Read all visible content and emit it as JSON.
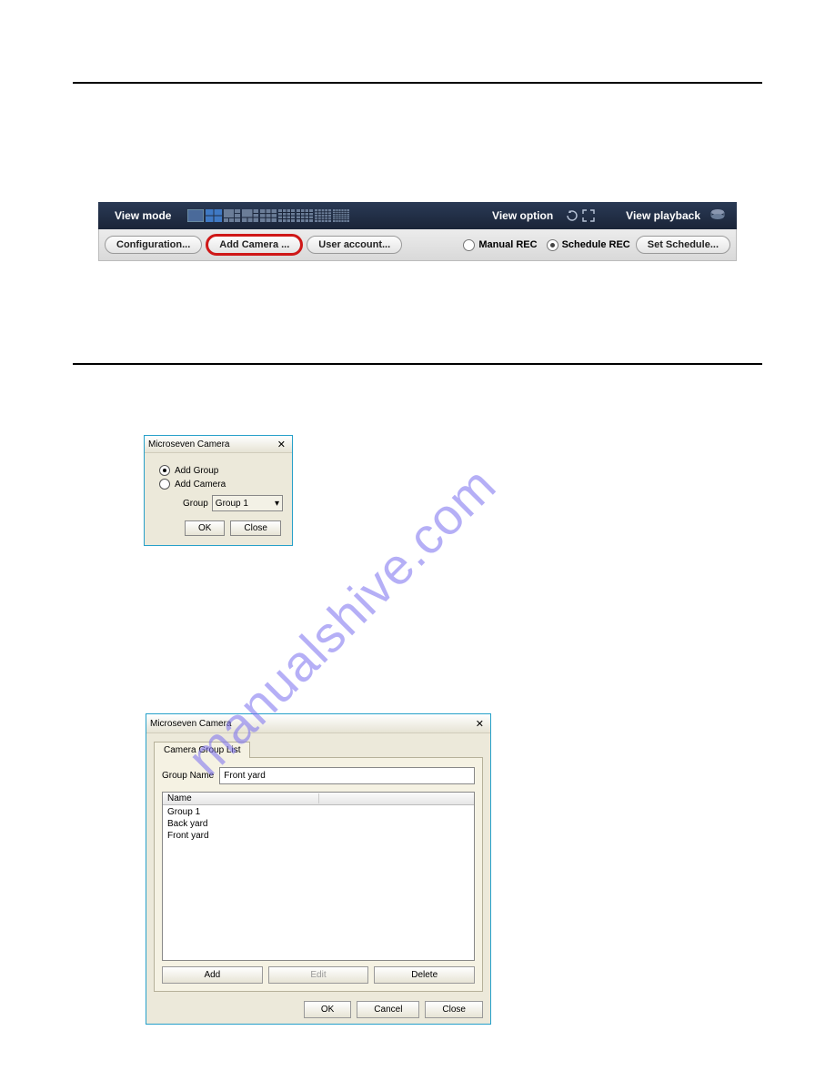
{
  "watermark": "manualshive.com",
  "toolbar": {
    "view_mode_label": "View mode",
    "view_option_label": "View option",
    "view_playback_label": "View playback",
    "configuration_label": "Configuration...",
    "add_camera_label": "Add Camera ...",
    "user_account_label": "User account...",
    "manual_rec_label": "Manual REC",
    "schedule_rec_label": "Schedule REC",
    "set_schedule_label": "Set Schedule..."
  },
  "dialog_small": {
    "title": "Microseven Camera",
    "add_group_label": "Add Group",
    "add_camera_label": "Add Camera",
    "group_label": "Group",
    "group_value": "Group 1",
    "ok_label": "OK",
    "close_label": "Close"
  },
  "dialog_large": {
    "title": "Microseven Camera",
    "tab_label": "Camera Group List",
    "group_name_label": "Group Name",
    "group_name_value": "Front yard",
    "list_header": "Name",
    "list_items": [
      "Group 1",
      "Back yard",
      "Front yard"
    ],
    "add_label": "Add",
    "edit_label": "Edit",
    "delete_label": "Delete",
    "ok_label": "OK",
    "cancel_label": "Cancel",
    "close_label": "Close"
  }
}
